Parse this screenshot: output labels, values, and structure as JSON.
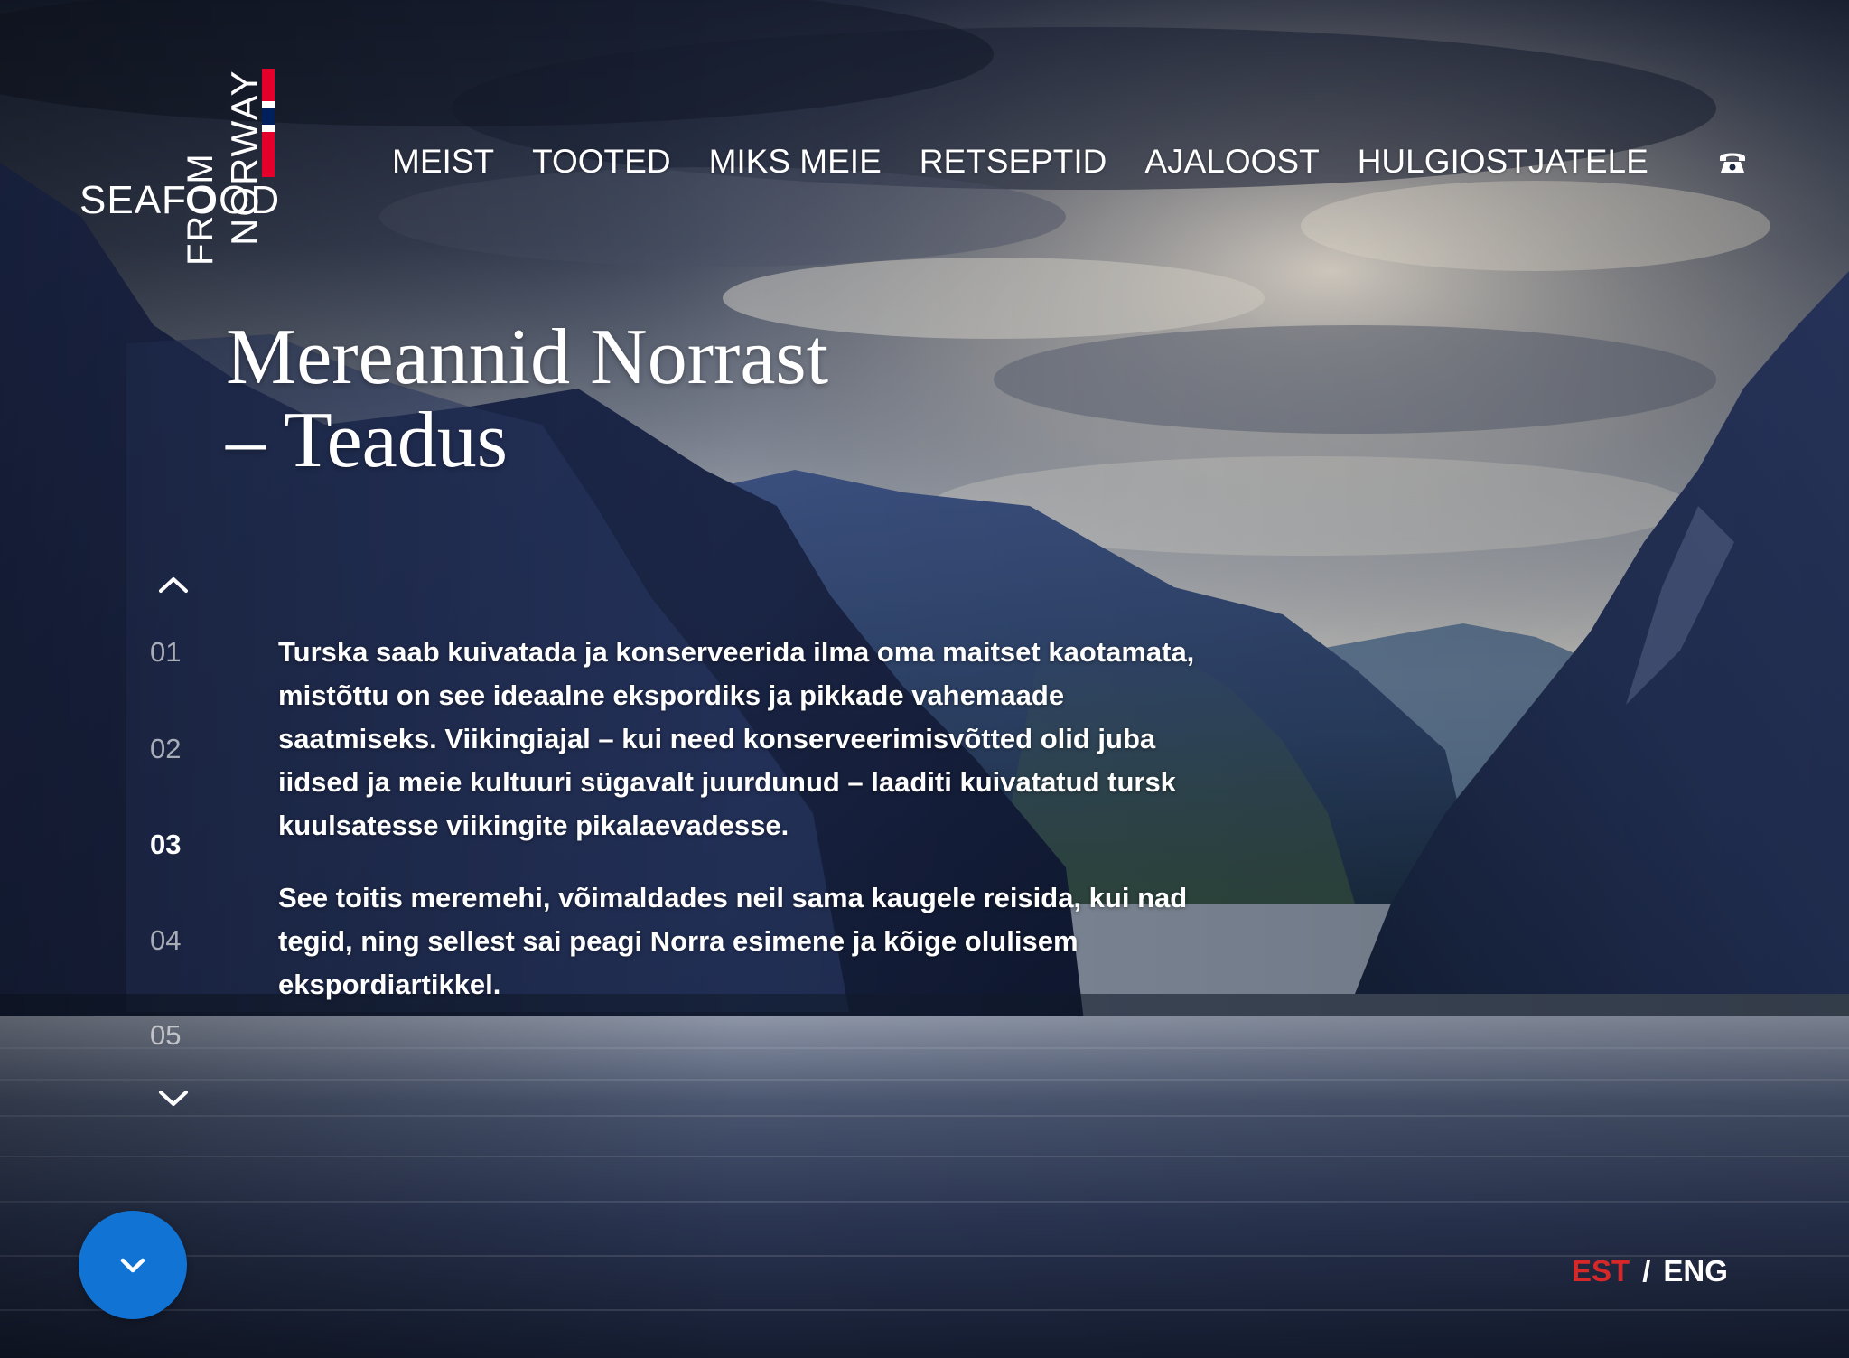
{
  "brand": {
    "logo_word_1": "SEAFOOD",
    "logo_word_2": "FROM",
    "logo_word_3": "NORWAY",
    "flag_colors": [
      "#e4002b",
      "#ffffff",
      "#00205b"
    ]
  },
  "nav": {
    "items": [
      {
        "label": "MEIST"
      },
      {
        "label": "TOOTED"
      },
      {
        "label": "MIKS MEIE"
      },
      {
        "label": "RETSEPTID"
      },
      {
        "label": "AJALOOST"
      },
      {
        "label": "HULGIOSTJATELE"
      }
    ],
    "phone_icon": "phone-icon"
  },
  "heading": {
    "line1": "Mereannid Norrast",
    "dash": "–",
    "line2": "Teadus"
  },
  "sections": {
    "items": [
      "01",
      "02",
      "03",
      "04",
      "05"
    ],
    "active": "03",
    "up_icon": "chevron-up-icon",
    "down_icon": "chevron-down-icon"
  },
  "body": {
    "paragraph1": "Turska saab kuivatada ja konserveerida ilma oma maitset kaotamata, mistõttu on see ideaalne ekspordiks ja pikkade vahemaade saatmiseks. Viikingiajal – kui need konserveerimisvõtted olid juba iidsed ja meie kultuuri sügavalt juurdunud – laaditi kuivatatud tursk kuulsatesse viikingite pikalaevadesse.",
    "paragraph2": "See toitis meremehi, võimaldades neil sama kaugele reisida, kui nad tegid, ning sellest sai peagi Norra esimene ja kõige olulisem ekspordiartikkel."
  },
  "scroll_button": {
    "icon": "chevron-down-icon",
    "color": "#1173d4"
  },
  "language": {
    "est": "EST",
    "separator": "/",
    "eng": "ENG",
    "active": "EST",
    "active_color": "#d62828"
  }
}
